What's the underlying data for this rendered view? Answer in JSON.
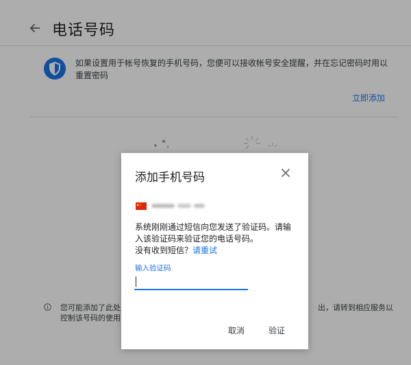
{
  "header": {
    "title": "电话号码",
    "back_icon": "arrow-left-icon"
  },
  "info_card": {
    "icon": "shield-icon",
    "text": "如果设置用于帐号恢复的手机号码，您便可以接收帐号安全提醒，并在忘记密码时用以重置密码",
    "add_link": "立即添加"
  },
  "footer_note": {
    "icon": "info-icon",
    "left_text": "您可能添加了此处未\n控制该号码的使用方",
    "right_text": "出，请转到相应服务以"
  },
  "dialog": {
    "title": "添加手机号码",
    "close_icon": "close-icon",
    "flag_icon": "china-flag-icon",
    "message_line": "系统刚刚通过短信向您发送了验证码。请输入该验证码来验证您的电话号码。",
    "no_sms": "没有收到短信？",
    "resend_link": "请重试",
    "code_label": "输入验证码",
    "code_value": "",
    "cancel_label": "取消",
    "verify_label": "验证"
  },
  "colors": {
    "accent": "#1a73e8",
    "shield": "#1a73e8",
    "flag_red": "#de2910",
    "flag_yellow": "#ffde00",
    "overlay": "rgba(0,0,0,0.32)"
  }
}
